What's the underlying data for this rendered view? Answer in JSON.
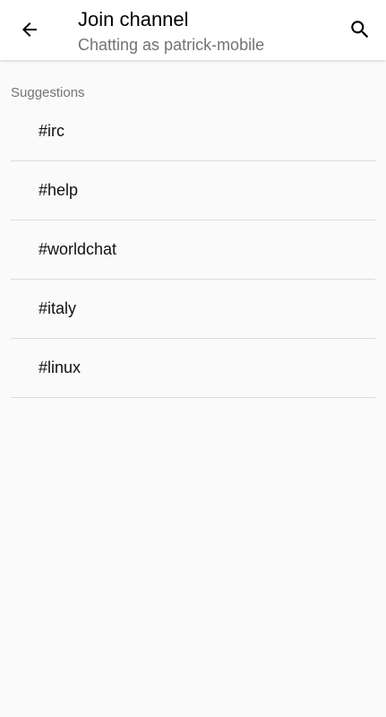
{
  "header": {
    "back_icon": "arrow-left-icon",
    "title": "Join channel",
    "subtitle": "Chatting as patrick-mobile",
    "search_icon": "search-icon"
  },
  "suggestions": {
    "label": "Suggestions",
    "items": [
      {
        "label": "#irc"
      },
      {
        "label": "#help"
      },
      {
        "label": "#worldchat"
      },
      {
        "label": "#italy"
      },
      {
        "label": "#linux"
      }
    ]
  },
  "colors": {
    "background": "#fafafa",
    "appbar": "#ffffff",
    "divider": "#dcdcdc",
    "subtitle": "#737373"
  }
}
